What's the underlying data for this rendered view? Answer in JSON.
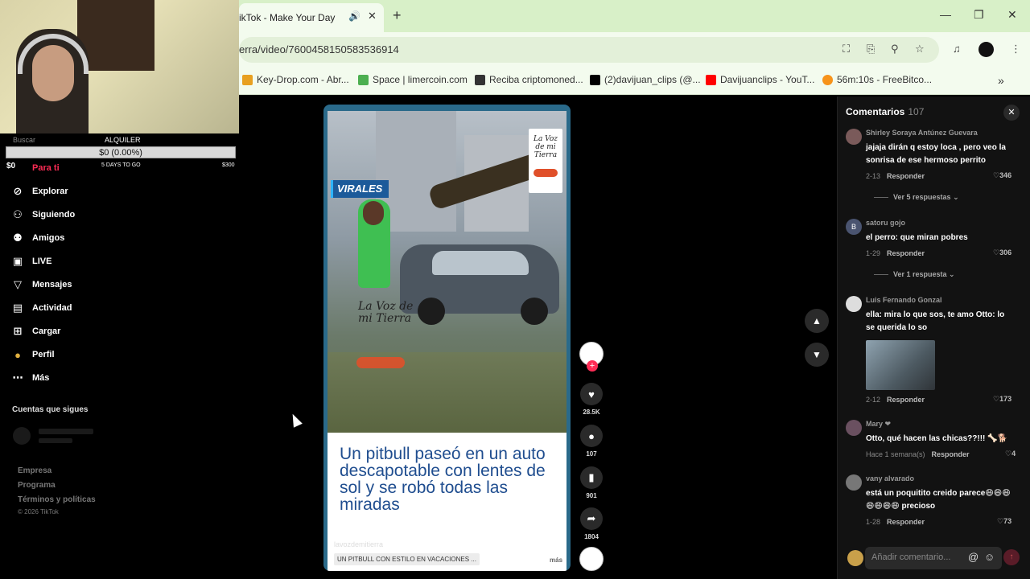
{
  "browser": {
    "tab_title": "ikTok - Make Your Day",
    "url": "erra/video/7600458150583536914",
    "bookmarks": [
      {
        "label": "Key-Drop.com - Abr...",
        "color": "#e8a020"
      },
      {
        "label": "Space | limercoin.com",
        "color": "#4caf50"
      },
      {
        "label": "Reciba criptomoned...",
        "color": "#333333"
      },
      {
        "label": "(2)davijuan_clips (@...",
        "color": "#000000"
      },
      {
        "label": "Davijuanclips - YouT...",
        "color": "#ff0000"
      },
      {
        "label": "56m:10s - FreeBitco...",
        "color": "#f7931a"
      }
    ]
  },
  "widget": {
    "search": "Buscar",
    "title": "ALQUILER",
    "progress_text": "$0 (0.00%)",
    "left_amount": "$0",
    "days": "5 DAYS TO GO",
    "goal": "$300"
  },
  "sidebar": {
    "items": [
      {
        "label": "Para ti",
        "icon": "home-icon"
      },
      {
        "label": "Explorar",
        "icon": "compass-icon"
      },
      {
        "label": "Siguiendo",
        "icon": "following-icon"
      },
      {
        "label": "Amigos",
        "icon": "friends-icon"
      },
      {
        "label": "LIVE",
        "icon": "live-icon"
      },
      {
        "label": "Mensajes",
        "icon": "messages-icon"
      },
      {
        "label": "Actividad",
        "icon": "activity-icon"
      },
      {
        "label": "Cargar",
        "icon": "upload-icon"
      },
      {
        "label": "Perfil",
        "icon": "profile-icon"
      },
      {
        "label": "Más",
        "icon": "more-icon"
      }
    ],
    "following_title": "Cuentas que sigues",
    "footer": [
      "Empresa",
      "Programa",
      "Términos y políticas"
    ],
    "copyright": "© 2026 TikTok"
  },
  "video": {
    "tag": "VIRALES",
    "logo_text": "La Voz de mi Tierra",
    "watermark": "La Voz de mi Tierra",
    "caption": "Un pitbull paseó en un auto descapotable con lentes de sol y se robó todas las miradas",
    "handle": "lavozdemitierra",
    "description": "UN PITBULL CON ESTILO EN VACACIONES ...",
    "more": "más"
  },
  "actions": {
    "likes": "28.5K",
    "comments": "107",
    "saves": "901",
    "shares": "1804"
  },
  "comments": {
    "title": "Comentarios",
    "count": "107",
    "input_placeholder": "Añadir comentario...",
    "items": [
      {
        "user": "Shirley Soraya Antúnez Guevara",
        "text": "jajaja dirán q estoy loca , pero veo la sonrisa de ese hermoso perrito",
        "date": "2-13",
        "reply": "Responder",
        "likes": "346",
        "replies": "Ver 5 respuestas"
      },
      {
        "user": "satoru gojo",
        "avatar_letter": "B",
        "text": "el perro: que miran pobres",
        "date": "1-29",
        "reply": "Responder",
        "likes": "306",
        "replies": "Ver 1 respuesta"
      },
      {
        "user": "Luis Fernando Gonzal",
        "text": "ella: mira lo que sos, te amo Otto: lo se querida lo so",
        "date": "2-12",
        "reply": "Responder",
        "likes": "173"
      },
      {
        "user": "Mary ❤",
        "text": "Otto, qué hacen las chicas??!!! 🦴🐕",
        "date": "Hace 1 semana(s)",
        "reply": "Responder",
        "likes": "4"
      },
      {
        "user": "vany alvarado",
        "text": "está un poquitito creido parece😄😄😄 😄😄😄😄 precioso",
        "date": "1-28",
        "reply": "Responder",
        "likes": "73"
      }
    ]
  }
}
